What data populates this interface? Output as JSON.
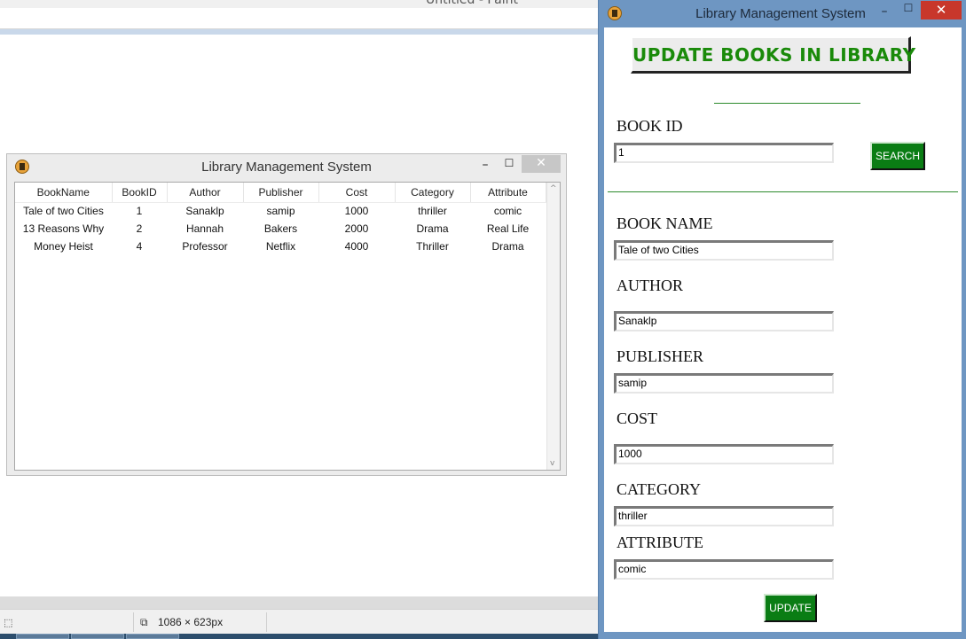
{
  "paint": {
    "title": "Untitled - Paint",
    "status_size": "1086 × 623px",
    "status_sel_icon": "⬚",
    "status_size_icon": "⧉"
  },
  "table_window": {
    "title": "Library Management System",
    "columns": [
      "BookName",
      "BookID",
      "Author",
      "Publisher",
      "Cost",
      "Category",
      "Attribute"
    ],
    "rows": [
      [
        "Tale of two Cities",
        "1",
        "Sanaklp",
        "samip",
        "1000",
        "thriller",
        "comic"
      ],
      [
        "13 Reasons Why",
        "2",
        "Hannah",
        "Bakers",
        "2000",
        "Drama",
        "Real Life"
      ],
      [
        "Money Heist",
        "4",
        "Professor",
        "Netflix",
        "4000",
        "Thriller",
        "Drama"
      ]
    ],
    "icons": {
      "minimize": "–",
      "maximize": "☐",
      "close": "✕",
      "scroll_up": "^",
      "scroll_down": "v"
    }
  },
  "update_window": {
    "title": "Library Management System",
    "heading": "UPDATE BOOKS IN LIBRARY",
    "icons": {
      "minimize": "–",
      "maximize": "☐",
      "close": "✕"
    },
    "book_id": {
      "label": "BOOK ID",
      "value": "1"
    },
    "search_label": "SEARCH",
    "book_name": {
      "label": "BOOK NAME",
      "value": "Tale of two Cities"
    },
    "author": {
      "label": "AUTHOR",
      "value": "Sanaklp"
    },
    "publisher": {
      "label": "PUBLISHER",
      "value": "samip"
    },
    "cost": {
      "label": "COST",
      "value": "1000"
    },
    "category": {
      "label": "CATEGORY",
      "value": "thriller"
    },
    "attribute": {
      "label": "ATTRIBUTE",
      "value": "comic"
    },
    "update_label": "UPDATE"
  },
  "colors": {
    "heading_green": "#1a8a0a",
    "button_green": "#0a7d14",
    "window_frame_blue": "#6e96c2",
    "close_red": "#c8372b"
  }
}
